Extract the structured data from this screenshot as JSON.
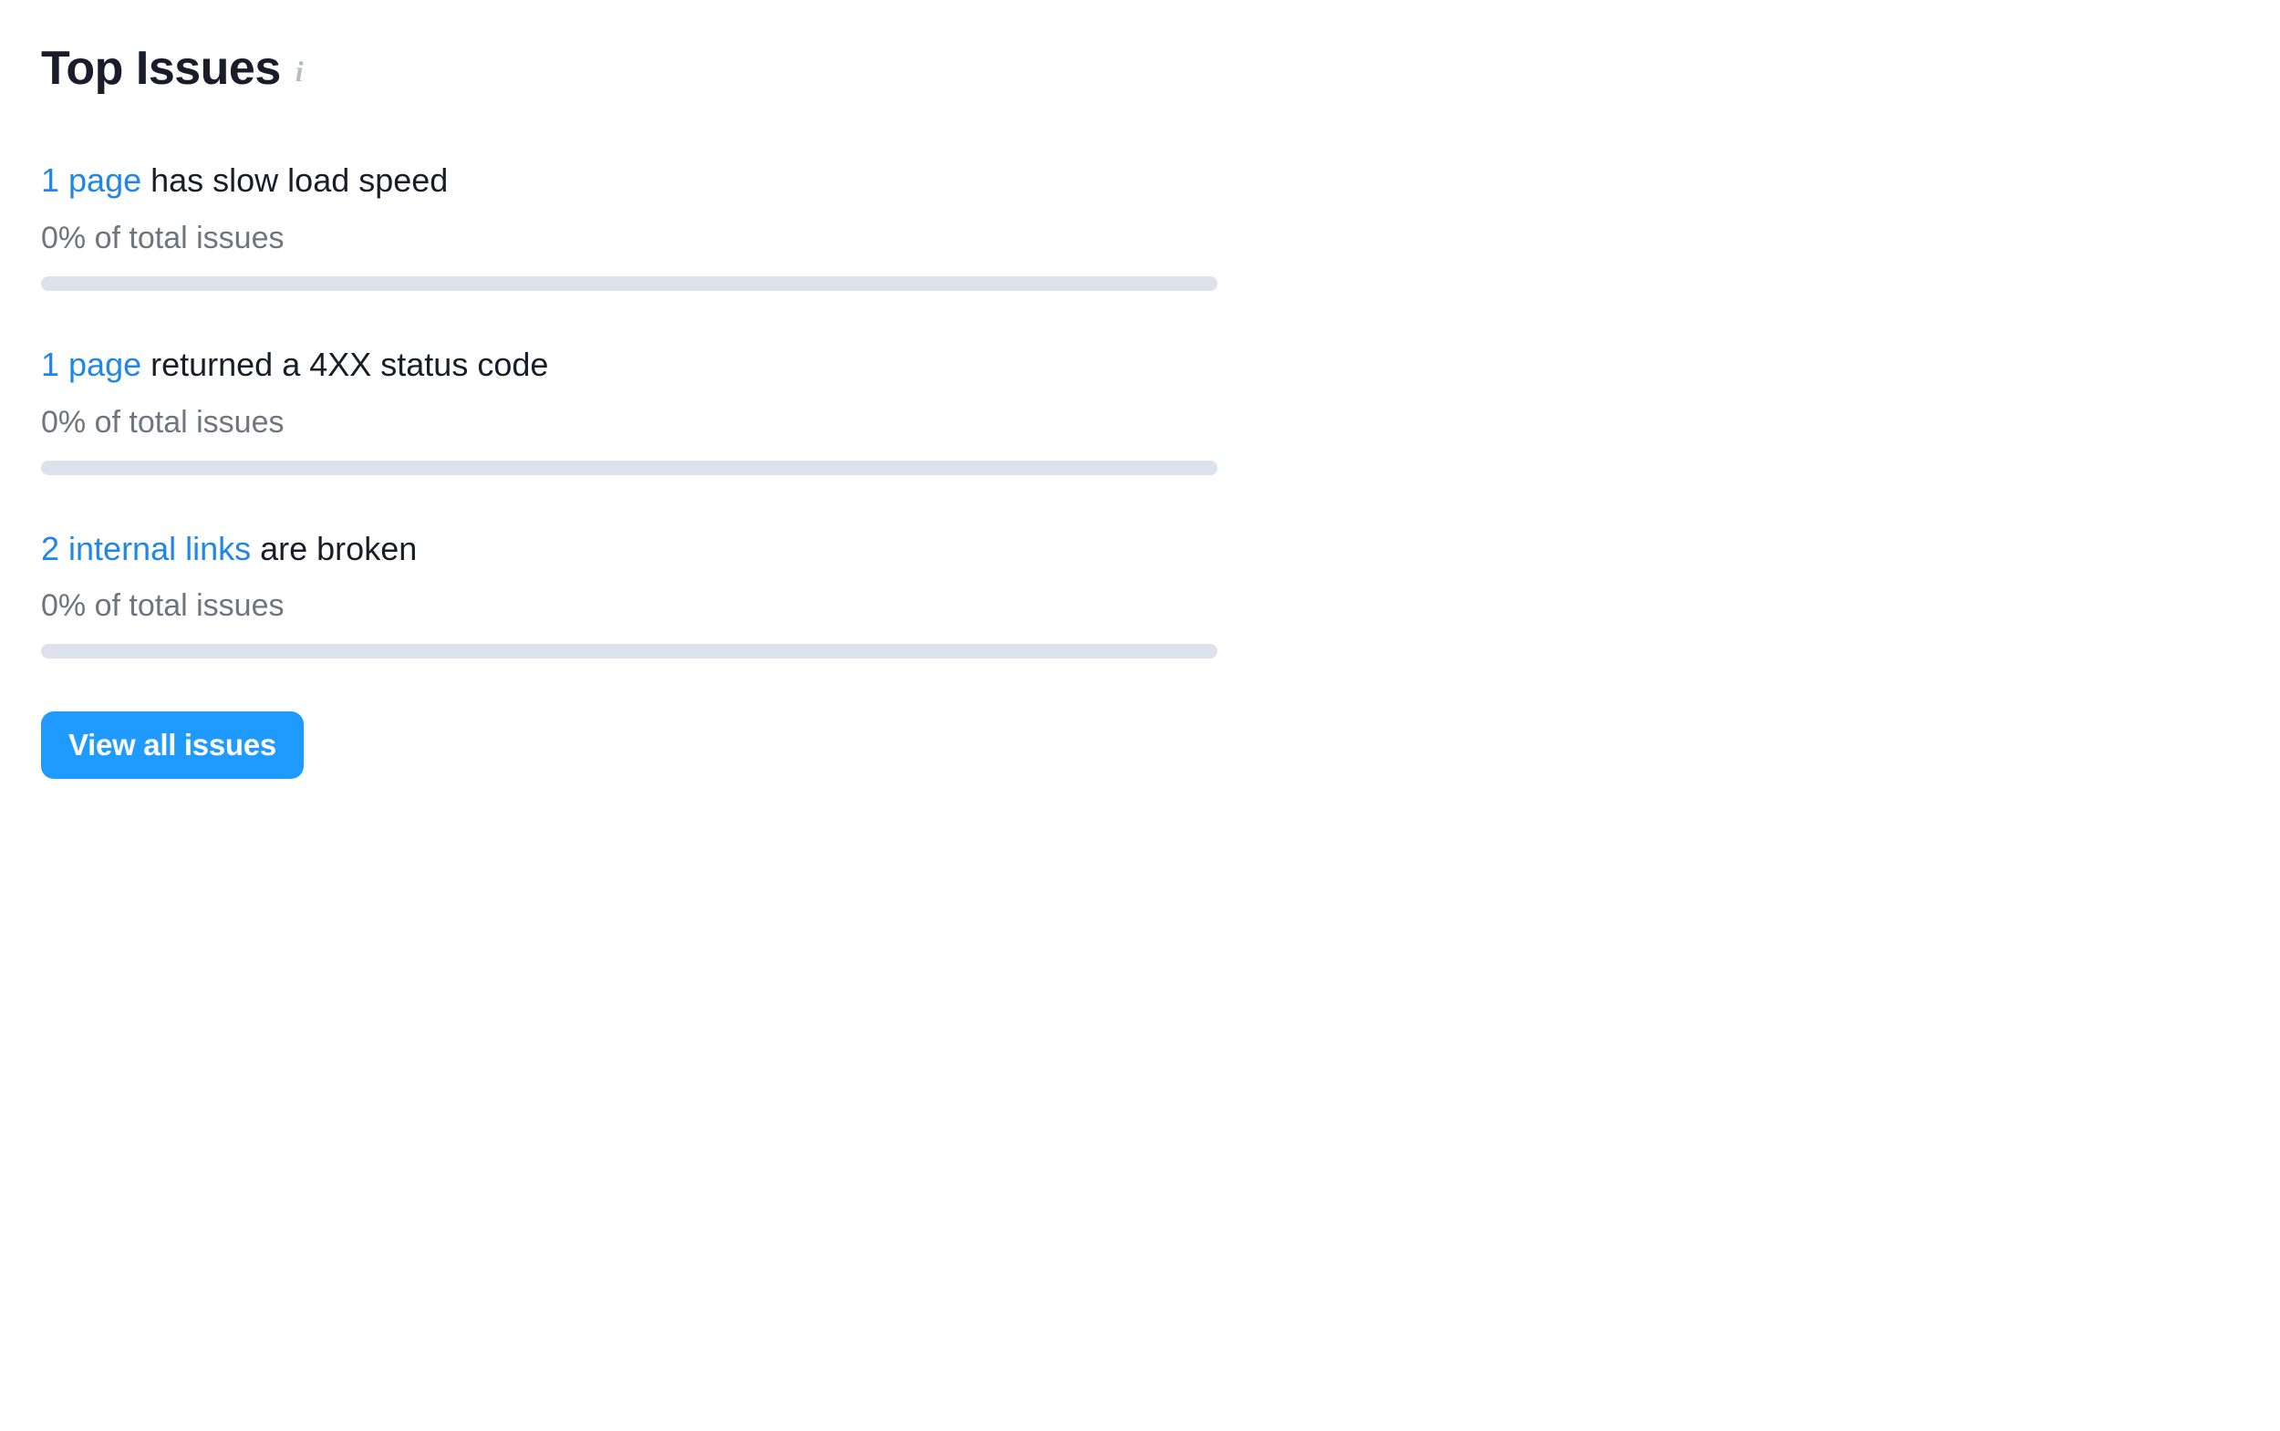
{
  "header": {
    "title": "Top Issues"
  },
  "issues": [
    {
      "link_text": "1 page",
      "description": " has slow load speed",
      "percent_text": "0% of total issues"
    },
    {
      "link_text": "1 page",
      "description": " returned a 4XX status code",
      "percent_text": "0% of total issues"
    },
    {
      "link_text": "2 internal links",
      "description": " are broken",
      "percent_text": "0% of total issues"
    }
  ],
  "buttons": {
    "view_all": "View all issues"
  }
}
